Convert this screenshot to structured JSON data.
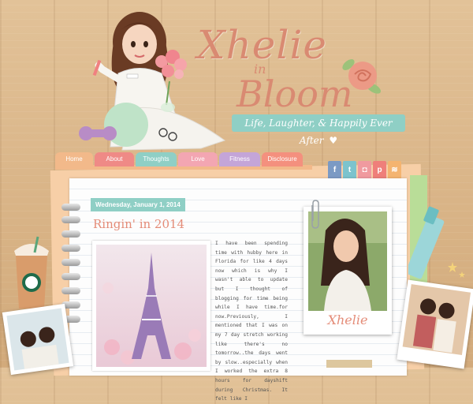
{
  "brand": {
    "title": "Xhelie",
    "in": "in",
    "bloom": "Bloom",
    "tagline": "Life, Laughter, & Happily Ever After"
  },
  "nav": {
    "items": [
      {
        "label": "Home",
        "color": "#f2b98a"
      },
      {
        "label": "About",
        "color": "#ef8a86"
      },
      {
        "label": "Thoughts",
        "color": "#8fcfc5"
      },
      {
        "label": "Love",
        "color": "#f3a6b2"
      },
      {
        "label": "Fitness",
        "color": "#c4a5d8"
      },
      {
        "label": "Disclosure",
        "color": "#f4907e"
      }
    ]
  },
  "social": [
    {
      "icon": "facebook-icon",
      "glyph": "f",
      "color": "#7b9ac4"
    },
    {
      "icon": "twitter-icon",
      "glyph": "t",
      "color": "#7cc3cd"
    },
    {
      "icon": "instagram-icon",
      "glyph": "◘",
      "color": "#f09a9f"
    },
    {
      "icon": "pinterest-icon",
      "glyph": "p",
      "color": "#ef7f7a"
    },
    {
      "icon": "rss-icon",
      "glyph": "≋",
      "color": "#f4b470"
    }
  ],
  "post": {
    "date": "Wednesday, January 1, 2014",
    "title": "Ringin' in 2014",
    "body": "I have been spending time with hubby here in Florida for like 4 days now which is why I wasn't able to update but I thought of blogging for time being while I have time.for now.Previously, I mentioned that I was on my 7 day stretch working like there's no tomorrow..the days went by slow..especially when I worked the extra 8 hours for dayshift during Christmas. It felt like I"
  },
  "sidebar": {
    "profile_name": "Xhelie"
  }
}
